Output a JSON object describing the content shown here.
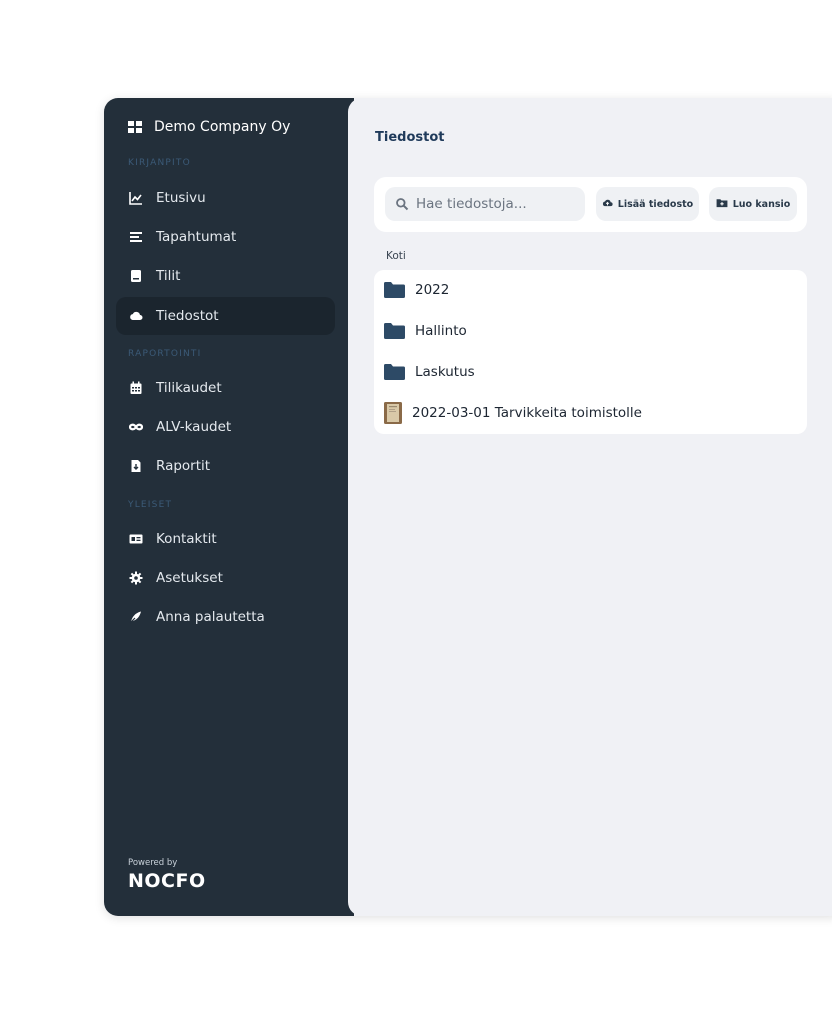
{
  "sidebar": {
    "company": "Demo Company Oy",
    "sections": {
      "kirjanpito": "KIRJANPITO",
      "raportointi": "RAPORTOINTI",
      "yleiset": "YLEISET"
    },
    "items": [
      {
        "label": "Etusivu",
        "icon": "chart-line-icon"
      },
      {
        "label": "Tapahtumat",
        "icon": "list-icon"
      },
      {
        "label": "Tilit",
        "icon": "book-icon"
      },
      {
        "label": "Tiedostot",
        "icon": "cloud-icon",
        "active": true
      },
      {
        "label": "Tilikaudet",
        "icon": "calendar-icon"
      },
      {
        "label": "ALV-kaudet",
        "icon": "infinity-icon"
      },
      {
        "label": "Raportit",
        "icon": "file-download-icon"
      },
      {
        "label": "Kontaktit",
        "icon": "id-card-icon"
      },
      {
        "label": "Asetukset",
        "icon": "gear-icon"
      },
      {
        "label": "Anna palautetta",
        "icon": "feather-pen-icon"
      }
    ],
    "powered_by": "Powered by",
    "logo_text": "NOCFO"
  },
  "main": {
    "title": "Tiedostot",
    "search": {
      "placeholder": "Hae tiedostoja..."
    },
    "buttons": {
      "upload": "Lisää tiedosto",
      "new_folder": "Luo kansio"
    },
    "breadcrumb": "Koti",
    "files": [
      {
        "name": "2022",
        "type": "folder"
      },
      {
        "name": "Hallinto",
        "type": "folder"
      },
      {
        "name": "Laskutus",
        "type": "folder"
      },
      {
        "name": "2022-03-01 Tarvikkeita toimistolle",
        "type": "image"
      }
    ]
  },
  "colors": {
    "sidebar_bg": "#232f3a",
    "sidebar_active": "#1b252e",
    "section_label": "#3b5a77",
    "main_bg": "#f0f1f5",
    "folder": "#2d4a66",
    "title": "#1f3a5a"
  }
}
